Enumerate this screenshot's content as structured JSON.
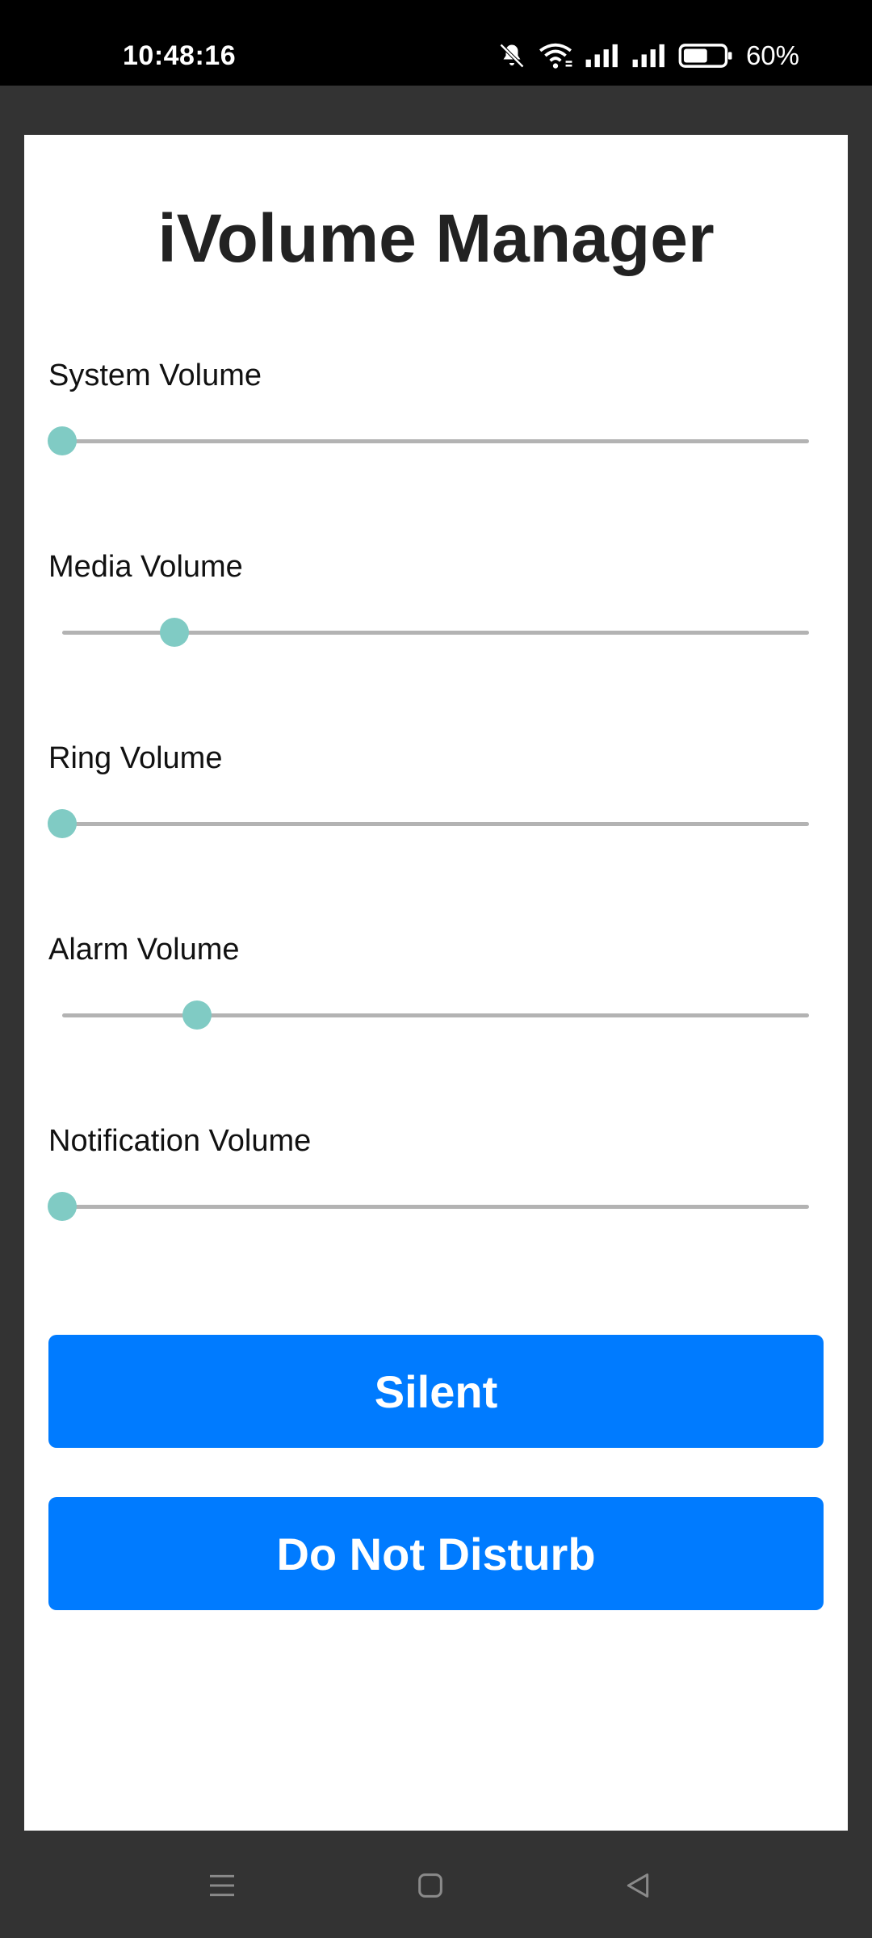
{
  "status_bar": {
    "time": "10:48:16",
    "battery_percent": "60%",
    "battery_level": 0.6,
    "icons": [
      "bell-muted-icon",
      "wifi-icon",
      "signal-icon",
      "signal-icon",
      "battery-icon"
    ]
  },
  "app": {
    "title": "iVolume Manager"
  },
  "sliders": [
    {
      "label": "System Volume",
      "value": 0.0
    },
    {
      "label": "Media Volume",
      "value": 0.15
    },
    {
      "label": "Ring Volume",
      "value": 0.0
    },
    {
      "label": "Alarm Volume",
      "value": 0.18
    },
    {
      "label": "Notification Volume",
      "value": 0.0
    }
  ],
  "buttons": {
    "silent_label": "Silent",
    "dnd_label": "Do Not Disturb"
  },
  "nav": {
    "icons": [
      "menu-icon",
      "home-icon",
      "back-icon"
    ]
  },
  "colors": {
    "accent": "#007bff",
    "slider_thumb": "#80cbc4",
    "slider_track": "#b3b3b3"
  }
}
